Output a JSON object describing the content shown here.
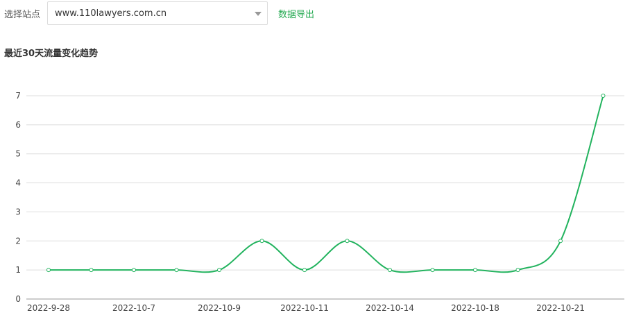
{
  "toolbar": {
    "site_label": "选择站点",
    "site_value": "www.110lawyers.com.cn",
    "export_label": "数据导出"
  },
  "chart_data": {
    "type": "line",
    "title": "最近30天流量变化趋势",
    "x": [
      "2022-9-28",
      "",
      "2022-10-7",
      "",
      "2022-10-9",
      "",
      "2022-10-11",
      "",
      "2022-10-14",
      "",
      "2022-10-18",
      "",
      "2022-10-21",
      ""
    ],
    "series": [
      {
        "values": [
          1,
          1,
          1,
          1,
          1,
          2,
          1,
          2,
          1,
          1,
          1,
          1,
          2,
          7
        ]
      }
    ],
    "ylim": [
      0,
      7
    ],
    "yticks": [
      0,
      1,
      2,
      3,
      4,
      5,
      6,
      7
    ],
    "grid": true,
    "color": "#22b35e"
  }
}
